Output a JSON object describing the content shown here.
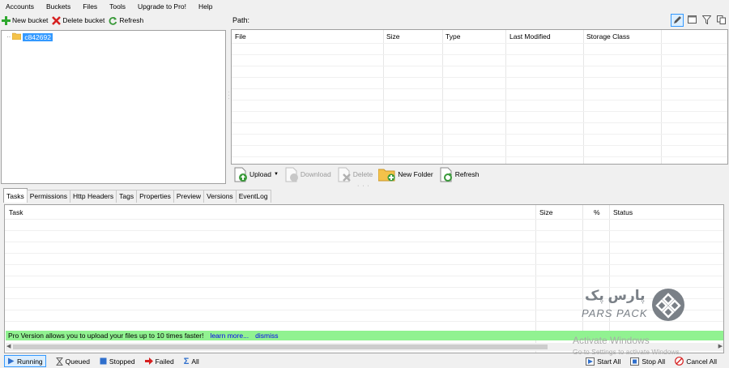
{
  "menu": [
    "Accounts",
    "Buckets",
    "Files",
    "Tools",
    "Upgrade to Pro!",
    "Help"
  ],
  "left_toolbar": {
    "new_bucket": "New bucket",
    "delete_bucket": "Delete bucket",
    "refresh": "Refresh"
  },
  "tree": {
    "bucket_name": "c842692"
  },
  "path_label": "Path:",
  "file_columns": {
    "file": "File",
    "size": "Size",
    "type": "Type",
    "last_modified": "Last Modified",
    "storage_class": "Storage Class"
  },
  "actions": {
    "upload": "Upload",
    "download": "Download",
    "delete": "Delete",
    "new_folder": "New Folder",
    "refresh": "Refresh"
  },
  "tabs": [
    "Tasks",
    "Permissions",
    "Http Headers",
    "Tags",
    "Properties",
    "Preview",
    "Versions",
    "EventLog"
  ],
  "task_columns": {
    "task": "Task",
    "size": "Size",
    "percent": "%",
    "status": "Status"
  },
  "promo": {
    "text": "Pro Version allows you to upload your files up to 10 times faster!",
    "learn_more": "learn more...",
    "dismiss": "dismiss"
  },
  "status_filters": {
    "running": "Running",
    "queued": "Queued",
    "stopped": "Stopped",
    "failed": "Failed",
    "all": "All"
  },
  "status_actions": {
    "start_all": "Start All",
    "stop_all": "Stop All",
    "cancel_all": "Cancel All"
  },
  "logo": {
    "farsi": "پارس پک",
    "english": "PARS PACK"
  },
  "watermark": {
    "line1": "Activate Windows",
    "line2": "Go to Settings to activate Windows."
  },
  "colors": {
    "selection": "#3399ff",
    "promo_bg": "#91f291",
    "link": "#0000ee",
    "logo_gray": "#7a8087"
  },
  "icons": {
    "new_bucket": "green-plus-icon",
    "delete_bucket": "red-x-icon",
    "refresh": "green-refresh-icon",
    "folder": "folder-icon",
    "running": "play-icon",
    "queued": "hourglass-icon",
    "stopped": "stop-icon",
    "failed": "red-arrow-icon",
    "all": "sigma-icon"
  }
}
